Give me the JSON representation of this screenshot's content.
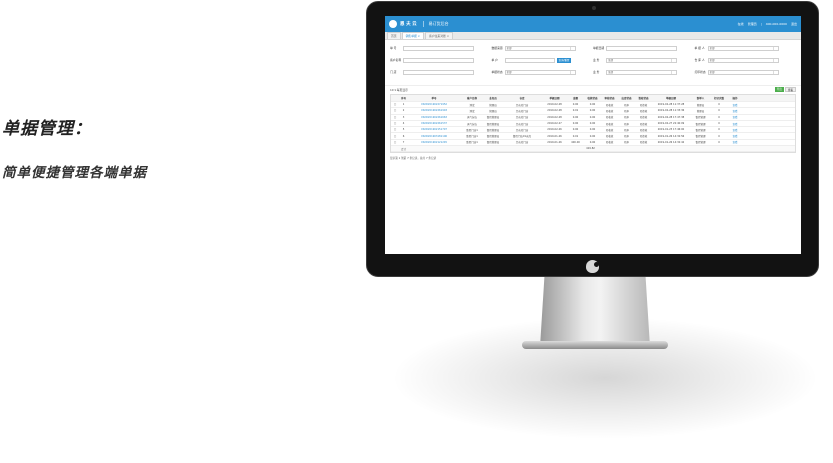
{
  "promo": {
    "title": "单据管理：",
    "subtitle": "简单便捷管理各端单据"
  },
  "app": {
    "brand": "恩 夫 云",
    "system_name": "易订货后台",
    "header_links": [
      "在线",
      "管理员",
      "|",
      "400-000-0000",
      "退出"
    ]
  },
  "tabs": [
    {
      "label": "首页",
      "active": false
    },
    {
      "label": "销售单据 ×",
      "active": true
    },
    {
      "label": "客户往来对账 ×",
      "active": false
    }
  ],
  "filters": {
    "rows": [
      [
        {
          "label": "单 号",
          "kind": "input",
          "value": ""
        },
        {
          "label": "数据来源",
          "kind": "select",
          "value": "全部"
        },
        {
          "label": "单据日期",
          "kind": "input",
          "value": ""
        },
        {
          "label": "单 据 人",
          "kind": "select",
          "value": "全部"
        }
      ],
      [
        {
          "label": "客户名称",
          "kind": "input",
          "value": ""
        },
        {
          "label": "单 户",
          "kind": "input",
          "value": ""
        },
        {
          "label": "业 务",
          "kind": "select",
          "value": "全部"
        },
        {
          "label": "仓 库 人",
          "kind": "select",
          "value": "全部"
        }
      ],
      [
        {
          "label": "门 店",
          "kind": "input",
          "value": ""
        },
        {
          "label": "单据状态",
          "kind": "select",
          "value": "全部"
        },
        {
          "label": "业 务",
          "kind": "select",
          "value": "全部"
        },
        {
          "label": "打印状态",
          "kind": "select",
          "value": "全部"
        }
      ]
    ],
    "search_label": "查询/重置"
  },
  "toolbar": {
    "page_size": "10 ▾  每页显示",
    "export_label": "导出",
    "refresh_label": "查看"
  },
  "grid": {
    "headers": [
      "",
      "序号",
      "单号",
      "客户名称",
      "业务员",
      "仓库",
      "单据日期",
      "金额",
      "收款状态",
      "审核状态",
      "出库状态",
      "签收状态",
      "单据日期",
      "制单人",
      "打印次数",
      "操作"
    ],
    "rows": [
      [
        "□",
        "1",
        "XSXD201902271952",
        "测试",
        "管理员",
        "主仓库门店",
        "2019-02-28",
        "0.00",
        "0.00",
        "已收款",
        "已审",
        "已签收",
        "2019-02-28 11:37:28",
        "管理员",
        "0",
        "查看"
      ],
      [
        "□",
        "2",
        "XSXD201902261918",
        "测试",
        "管理员",
        "主仓库门店",
        "2019-02-28",
        "0.01",
        "0.00",
        "已收款",
        "已审",
        "已签收",
        "2019-02-28 11:33:36",
        "管理员",
        "0",
        "查看"
      ],
      [
        "□",
        "3",
        "XSXD201902261663",
        "天气分店",
        "鲁巴管理员",
        "主仓库门店",
        "2019-02-28",
        "0.00",
        "0.00",
        "已收款",
        "已审",
        "已签收",
        "2019-02-28 17:47:38",
        "鲁巴管理",
        "0",
        "查看"
      ],
      [
        "□",
        "4",
        "XSXD201902261537",
        "天气分店",
        "鲁巴管理员",
        "主仓库门店",
        "2019-02-27",
        "0.00",
        "0.00",
        "已收款",
        "已审",
        "已签收",
        "2019-02-27 22:40:09",
        "鲁巴管理",
        "0",
        "查看"
      ],
      [
        "□",
        "5",
        "XSXD201902151797",
        "鲁巴门店1",
        "鲁巴管理员",
        "主仓库门店",
        "2019-02-26",
        "0.00",
        "0.00",
        "已收款",
        "已审",
        "已签收",
        "2019-01-23 17:46:00",
        "鲁巴管理",
        "0",
        "查看"
      ],
      [
        "□",
        "6",
        "XSXD201903181106",
        "鲁巴门店1",
        "鲁巴管理员",
        "鲁巴门店01仓库",
        "2019-01-26",
        "0.01",
        "0.00",
        "已收款",
        "已审",
        "已签收",
        "2019-01-26 14:32:56",
        "鲁巴管理",
        "0",
        "查看"
      ],
      [
        "□",
        "7",
        "XSXD201902121245",
        "鲁巴门店1",
        "鲁巴管理员",
        "主仓库门店",
        "2019-01-26",
        "400.00",
        "0.00",
        "已收款",
        "已审",
        "已签收",
        "2019-01-26 14:32:42",
        "鲁巴管理",
        "0",
        "查看"
      ]
    ],
    "total_label": "合计",
    "total_amount": "419.82"
  },
  "footer": "显示第 1 到第 7 条记录，总共 7 条记录"
}
